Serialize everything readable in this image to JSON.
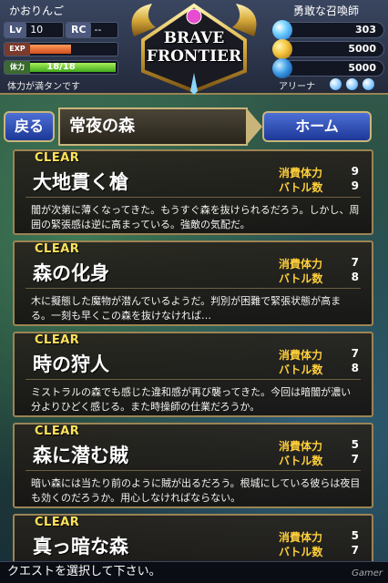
{
  "header": {
    "player_name": "かおりんご",
    "level_label": "Lv",
    "level_value": "10",
    "rc_label": "RC",
    "rc_value": "--",
    "exp_label": "EXP",
    "exp_fraction": 0.48,
    "stamina_label": "体力",
    "stamina_text": "18/18",
    "stamina_fraction": 1.0,
    "stamina_note": "体力が満タンです",
    "rank_title": "勇敢な召喚師",
    "gems": "303",
    "zel": "5000",
    "karma": "5000",
    "arena_label": "アリーナ",
    "arena_orbs": 3
  },
  "logo": {
    "line1": "BRAVE",
    "line2": "FRONTIER"
  },
  "nav": {
    "back_label": "戻る",
    "area_title": "常夜の森",
    "home_label": "ホーム"
  },
  "quests": [
    {
      "status": "CLEAR",
      "name": "大地貫く槍",
      "stamina_label": "消費体力",
      "stamina": "9",
      "battles_label": "バトル数",
      "battles": "9",
      "desc": "闇が次第に薄くなってきた。もうすぐ森を抜けられるだろう。しかし、周囲の緊張感は逆に高まっている。強敵の気配だ。"
    },
    {
      "status": "CLEAR",
      "name": "森の化身",
      "stamina_label": "消費体力",
      "stamina": "7",
      "battles_label": "バトル数",
      "battles": "8",
      "desc": "木に擬態した魔物が潜んでいるようだ。判別が困難で緊張状態が高まる。一刻も早くこの森を抜けなければ…"
    },
    {
      "status": "CLEAR",
      "name": "時の狩人",
      "stamina_label": "消費体力",
      "stamina": "7",
      "battles_label": "バトル数",
      "battles": "8",
      "desc": "ミストラルの森でも感じた違和感が再び襲ってきた。今回は暗闇が濃い分よりひどく感じる。また時操師の仕業だろうか。"
    },
    {
      "status": "CLEAR",
      "name": "森に潜む賊",
      "stamina_label": "消費体力",
      "stamina": "5",
      "battles_label": "バトル数",
      "battles": "7",
      "desc": "暗い森には当たり前のように賊が出るだろう。根城にしている彼らは夜目も効くのだろうか。用心しなければならない。"
    },
    {
      "status": "CLEAR",
      "name": "真っ暗な森",
      "stamina_label": "消費体力",
      "stamina": "5",
      "battles_label": "バトル数",
      "battles": "7",
      "desc": ""
    }
  ],
  "footer": {
    "text": "クエストを選択して下さい。",
    "watermark": "Gamer"
  },
  "colors": {
    "accent_gold": "#ffcf3a",
    "clear_yellow": "#ffe35a",
    "button_blue": "#1d3897",
    "frame_gold": "#9b8454"
  }
}
